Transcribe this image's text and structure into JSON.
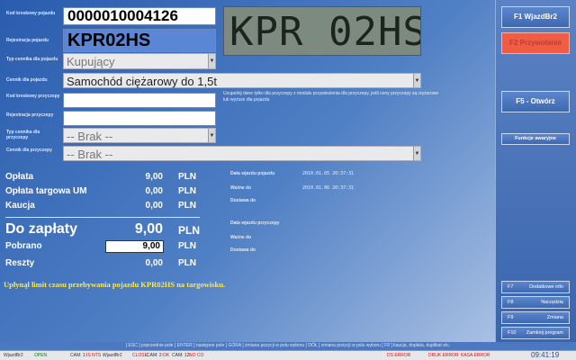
{
  "vehicle": {
    "barcode_label": "Kod kreskowy pojazdu",
    "barcode_value": "0000010004126",
    "reg_label": "Rejestracja pojazdu",
    "reg_value": "KPR02HS",
    "type_label": "Typ cennika dla pojazdu",
    "type_value": "Kupujący",
    "pricelist_label": "Cennik dla pojazdu",
    "pricelist_value": "Samochód ciężarowy do 1,5t",
    "plate_text": "KPR 02HS"
  },
  "trailer": {
    "barcode_label": "Kod kreskowy przyczepy",
    "reg_label": "Rejestracja przyczepy",
    "type_label": "Typ cennika dla przyczepy",
    "type_value": "-- Brak --",
    "pricelist_label": "Cennik dla przyczepy",
    "pricelist_value": "-- Brak --",
    "note": "Uzupełnij dane tylko dla przyczepy z modułu przywiezienia dla przyczepy, jeśli ceny przyczepy są ciężarowe lub wyższe dla pojazdu"
  },
  "fees": {
    "oplata_label": "Opłata",
    "oplata_value": "9,00",
    "targowa_label": "Opłata targowa UM",
    "targowa_value": "0,00",
    "kaucja_label": "Kaucja",
    "kaucja_value": "0,00",
    "total_label": "Do zapłaty",
    "total_value": "9,00",
    "pobrano_label": "Pobrano",
    "pobrano_value": "9,00",
    "reszty_label": "Reszty",
    "reszty_value": "0,00",
    "currency": "PLN"
  },
  "entry": {
    "vehicle_entry_label": "Data wjazdu pojazdu",
    "vehicle_entry_value": "2010.01.05 20:37:31",
    "valid_label": "Ważne do",
    "valid_value": "2010.01.06 20:37:31",
    "extra_label": "Dostawa do",
    "trailer_entry_label": "Data wjazdu przyczepy",
    "trailer_valid_label": "Ważne do",
    "trailer_extra_label": "Dostawa do"
  },
  "warning": "Upłynął limit czasu przebywania pojazdu KPR02HS na targowisku.",
  "right_panel": {
    "f1": "F1 WjazdBr2",
    "red_button": "F2 Przywołanie",
    "f5": "F5 - Otwórz",
    "emergency": "Funkcje awaryjne",
    "small": [
      {
        "key": "F7",
        "label": "Dodatkowe info"
      },
      {
        "key": "F8",
        "label": "Narzędzia"
      },
      {
        "key": "F9",
        "label": "Zmiana"
      },
      {
        "key": "F10",
        "label": "Zamknij program"
      }
    ]
  },
  "hints": "[ ESC ] poprzednie pole  [ ENTER ] następne pole  [ GÓRA ] zmiana pozycji w polu wyboru  [ DÓŁ ] zmiana pozycji w polu wyboru  [ F8 ] kaucja, dopłata, duplikat etc.",
  "status": {
    "a": "WjazdBr2",
    "a_state": "OPEN",
    "b": "CAM: 1:",
    "b_val": "IS NTS",
    "c": "WjazdBr2",
    "c_state": "CLOSE",
    "d": "CAM: 2:",
    "d_val": "OK",
    "e": "CAM: 12:",
    "e_val": "NO CO",
    "err1": "DS ERROR",
    "err2": "DRUK ERROR",
    "err3": "KASA ERROR",
    "clock": "09:41:19"
  },
  "colors": {
    "accent": "#2a5cae",
    "warning": "#ffe94a",
    "red_button": "#f15c45"
  }
}
